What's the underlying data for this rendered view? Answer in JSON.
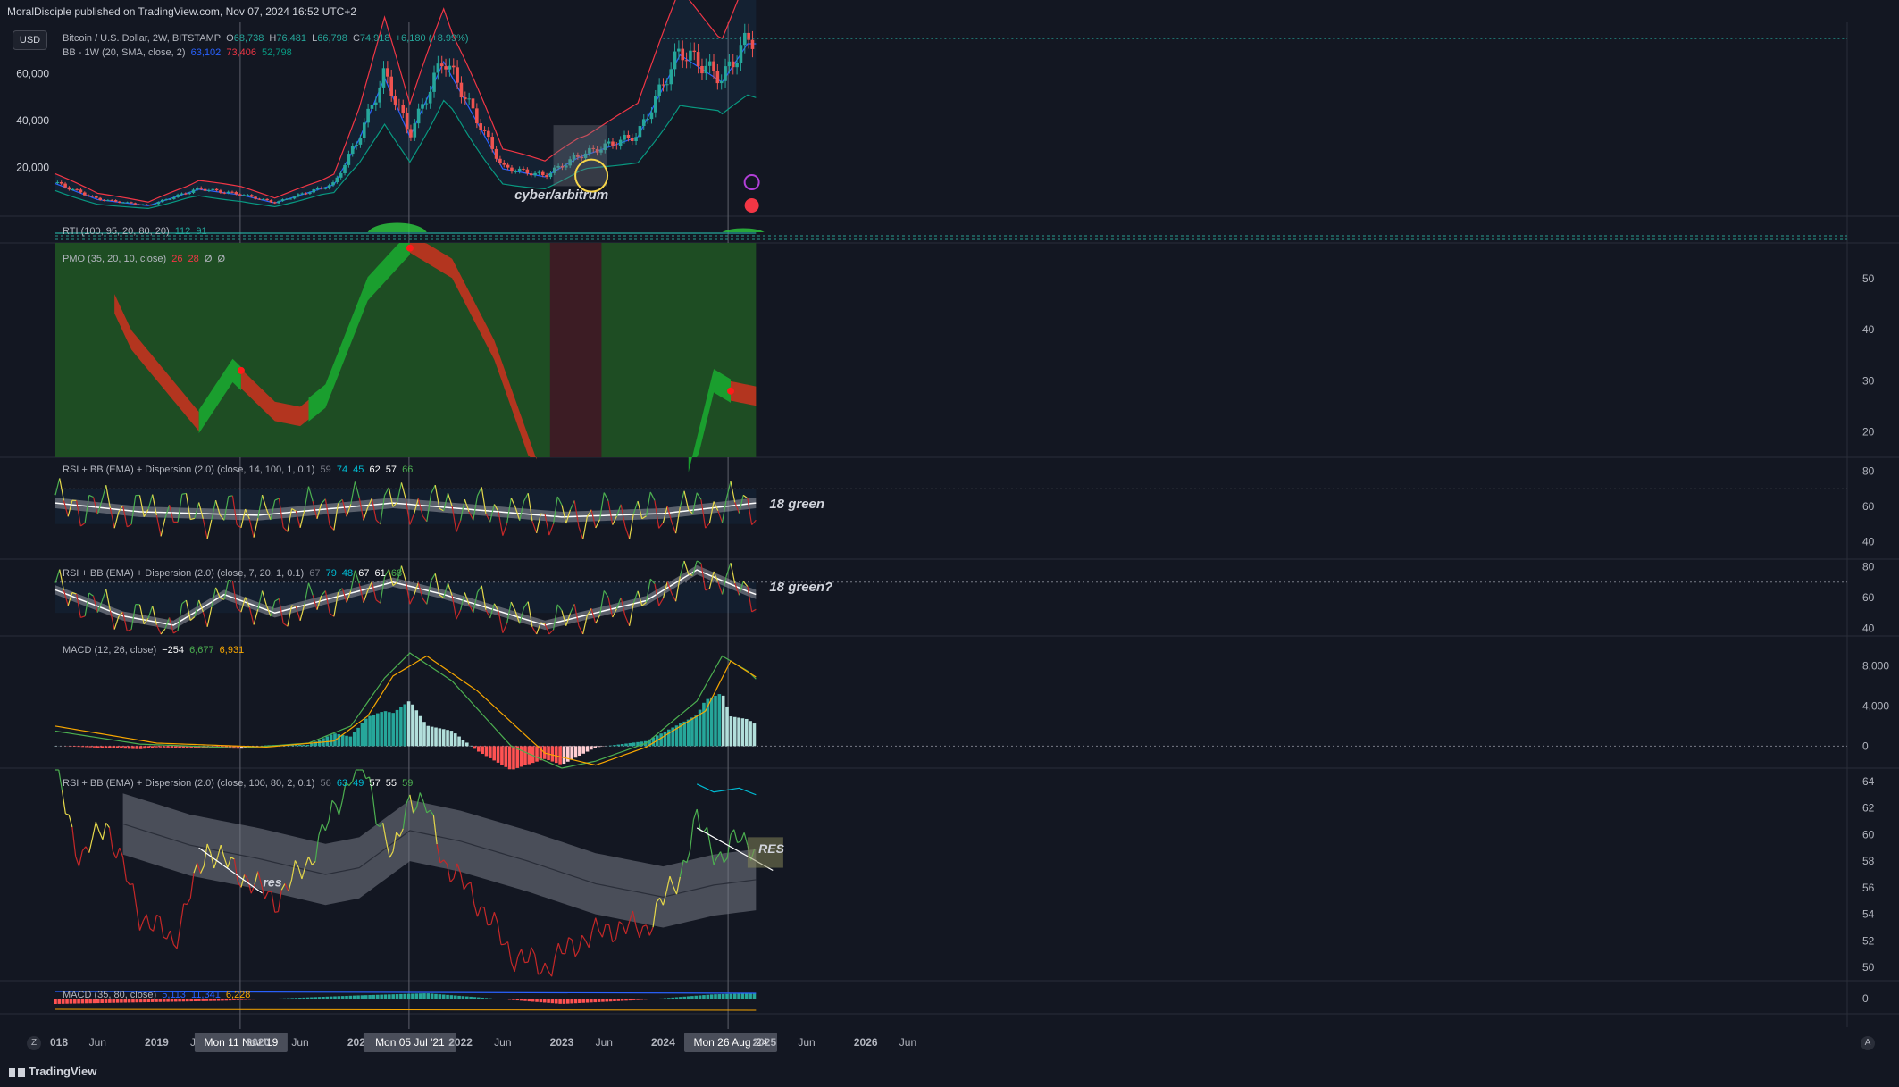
{
  "published": "MoralDisciple published on TradingView.com, Nov 07, 2024 16:52 UTC+2",
  "currency_button": "USD",
  "footer_brand": "TradingView",
  "nav_left": "Z",
  "nav_right": "A",
  "colors": {
    "background": "#131722",
    "up": "#26a69a",
    "down": "#ef5350",
    "bb_upper": "#f23645",
    "bb_basis": "#2962ff",
    "bb_lower": "#089981",
    "pmo_green": "#1a9e2e",
    "pmo_red": "#b3351f",
    "macd_signal": "#f7a600",
    "yellow": "#e6d84a"
  },
  "legend": {
    "main": {
      "symbol": "Bitcoin / U.S. Dollar, 2W, BITSTAMP",
      "o_label": "O",
      "o": "68,738",
      "h_label": "H",
      "h": "76,481",
      "l_label": "L",
      "l": "66,798",
      "c_label": "C",
      "c": "74,918",
      "change": "+6,180 (+8.99%)"
    },
    "bb": {
      "label": "BB - 1W (20, SMA, close, 2)",
      "v1": "63,102",
      "v2": "73,406",
      "v3": "52,798"
    },
    "rti": {
      "label": "RTI (100, 95, 20, 80, 20)",
      "v1": "112",
      "v2": "91"
    },
    "pmo": {
      "label": "PMO (35, 20, 10, close)",
      "v1": "26",
      "v2": "28",
      "v3": "Ø",
      "v4": "Ø"
    },
    "rsi1": {
      "label": "RSI + BB (EMA) + Dispersion (2.0) (close, 14, 100, 1, 0.1)",
      "v0": "59",
      "v1": "74",
      "v2": "45",
      "v3": "62",
      "v4": "57",
      "v5": "66"
    },
    "rsi2": {
      "label": "RSI + BB (EMA) + Dispersion (2.0) (close, 7, 20, 1, 0.1)",
      "v0": "67",
      "v1": "79",
      "v2": "48",
      "v3": "67",
      "v4": "61",
      "v5": "68"
    },
    "macd1": {
      "label": "MACD (12, 26, close)",
      "v1": "−254",
      "v2": "6,677",
      "v3": "6,931"
    },
    "rsi3": {
      "label": "RSI + BB (EMA) + Dispersion (2.0) (close, 100, 80, 2, 0.1)",
      "v0": "56",
      "v1": "63",
      "v2": "49",
      "v3": "57",
      "v4": "55",
      "v5": "59"
    },
    "macd2": {
      "label": "MACD (35, 80, close)",
      "v1": "5,113",
      "v2": "11,341",
      "v3": "6,228"
    }
  },
  "annotations": {
    "cyber": "cyber/arbitrum",
    "green18": "18 green",
    "green18q": "18 green?",
    "res_upper": "RES",
    "res_lower": "res"
  },
  "vertical_markers": [
    "Mon 11 Nov '19",
    "Mon 05 Jul '21",
    "Mon 26 Aug '24"
  ],
  "chart_data": {
    "type": "line",
    "x_axis_labels": [
      "018",
      "Jun",
      "2019",
      "Jun",
      "Mon 11 Nov '19",
      "2020",
      "Jun",
      "2021",
      "Mon 05 Jul '21",
      "2022",
      "Jun",
      "2023",
      "Jun",
      "2024",
      "Jun",
      "Mon 26 Aug '24",
      "2025",
      "Jun",
      "2026",
      "Jun"
    ],
    "panes": [
      {
        "name": "price",
        "ylabel": "",
        "yticks": [
          "20,000",
          "40,000",
          "60,000"
        ],
        "ylim": [
          0,
          78000
        ],
        "series_name": "Bitcoin / U.S. Dollar, 2W, BITSTAMP",
        "points": [
          [
            "2018-01",
            13500
          ],
          [
            "2018-06",
            6500
          ],
          [
            "2018-12",
            3800
          ],
          [
            "2019-06",
            11000
          ],
          [
            "2019-11",
            8500
          ],
          [
            "2020-03",
            5000
          ],
          [
            "2020-10",
            13000
          ],
          [
            "2021-01",
            33000
          ],
          [
            "2021-04",
            60000
          ],
          [
            "2021-07",
            34000
          ],
          [
            "2021-11",
            67000
          ],
          [
            "2022-06",
            20000
          ],
          [
            "2022-11",
            16500
          ],
          [
            "2023-03",
            25000
          ],
          [
            "2023-10",
            34000
          ],
          [
            "2024-03",
            70000
          ],
          [
            "2024-08",
            58000
          ],
          [
            "2024-11",
            74918
          ]
        ]
      },
      {
        "name": "PMO",
        "yticks": [
          "20",
          "30",
          "40",
          "50"
        ],
        "ylim": [
          15,
          57
        ]
      },
      {
        "name": "RSI 14",
        "yticks": [
          "40",
          "60",
          "80"
        ],
        "ylim": [
          30,
          88
        ]
      },
      {
        "name": "RSI 7",
        "yticks": [
          "40",
          "60",
          "80"
        ],
        "ylim": [
          35,
          85
        ]
      },
      {
        "name": "MACD 12/26",
        "yticks": [
          "0",
          "4,000",
          "8,000"
        ],
        "ylim": [
          -2200,
          11000
        ]
      },
      {
        "name": "RSI 100",
        "yticks": [
          "50",
          "52",
          "54",
          "56",
          "58",
          "60",
          "62",
          "64"
        ],
        "ylim": [
          49,
          65
        ]
      },
      {
        "name": "MACD 35/80",
        "yticks": [
          "0"
        ],
        "ylim": [
          -1,
          1
        ]
      }
    ]
  }
}
